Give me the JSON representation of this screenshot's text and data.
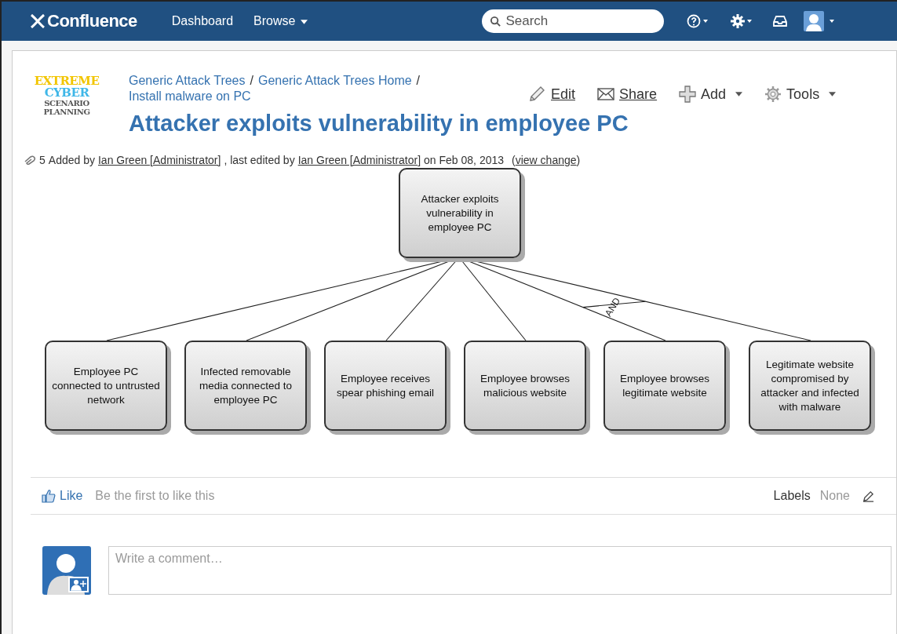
{
  "header": {
    "brand": "Confluence",
    "nav": [
      {
        "label": "Dashboard",
        "dropdown": false
      },
      {
        "label": "Browse",
        "dropdown": true
      }
    ],
    "search": {
      "placeholder": "Search"
    }
  },
  "logo": {
    "lines": [
      "EXTREME",
      "CYBER",
      "SCENARIO",
      "PLANNING"
    ]
  },
  "breadcrumbs": [
    "Generic Attack Trees",
    "Generic Attack Trees Home",
    "Install malware on PC"
  ],
  "breadcrumb_separator": "/",
  "actions": [
    {
      "label": "Edit",
      "kind": "edit",
      "dropdown": false
    },
    {
      "label": "Share",
      "kind": "share",
      "dropdown": false
    },
    {
      "label": "Add",
      "kind": "add",
      "dropdown": true
    },
    {
      "label": "Tools",
      "kind": "tools",
      "dropdown": true
    }
  ],
  "title": "Attacker exploits vulnerability in employee PC",
  "meta": {
    "attachments": "5",
    "added_by": "Added by",
    "author": "Ian Green [Administrator]",
    "edited_by": ", last edited by",
    "editor": "Ian Green [Administrator]",
    "date": "on Feb 08, 2013",
    "open": "(",
    "link": "view change",
    "close": ")"
  },
  "diagram": {
    "root": "Attacker exploits vulnerability in employee PC",
    "children": [
      {
        "kind": "node",
        "label": "Employee PC connected to untrusted network"
      },
      {
        "kind": "node",
        "label": "Infected removable media connected to employee PC"
      },
      {
        "kind": "node",
        "label": "Employee receives spear phishing email"
      },
      {
        "kind": "node",
        "label": "Employee browses malicious website"
      },
      {
        "kind": "and",
        "label": "AND",
        "children": [
          {
            "label": "Employee browses legitimate website"
          },
          {
            "label": "Legitimate website compromised by attacker and infected with malware"
          }
        ]
      }
    ]
  },
  "like": {
    "label": "Like",
    "hint": "Be the first to like this"
  },
  "labels": {
    "label": "Labels",
    "value": "None"
  },
  "comment": {
    "placeholder": "Write a comment…"
  }
}
